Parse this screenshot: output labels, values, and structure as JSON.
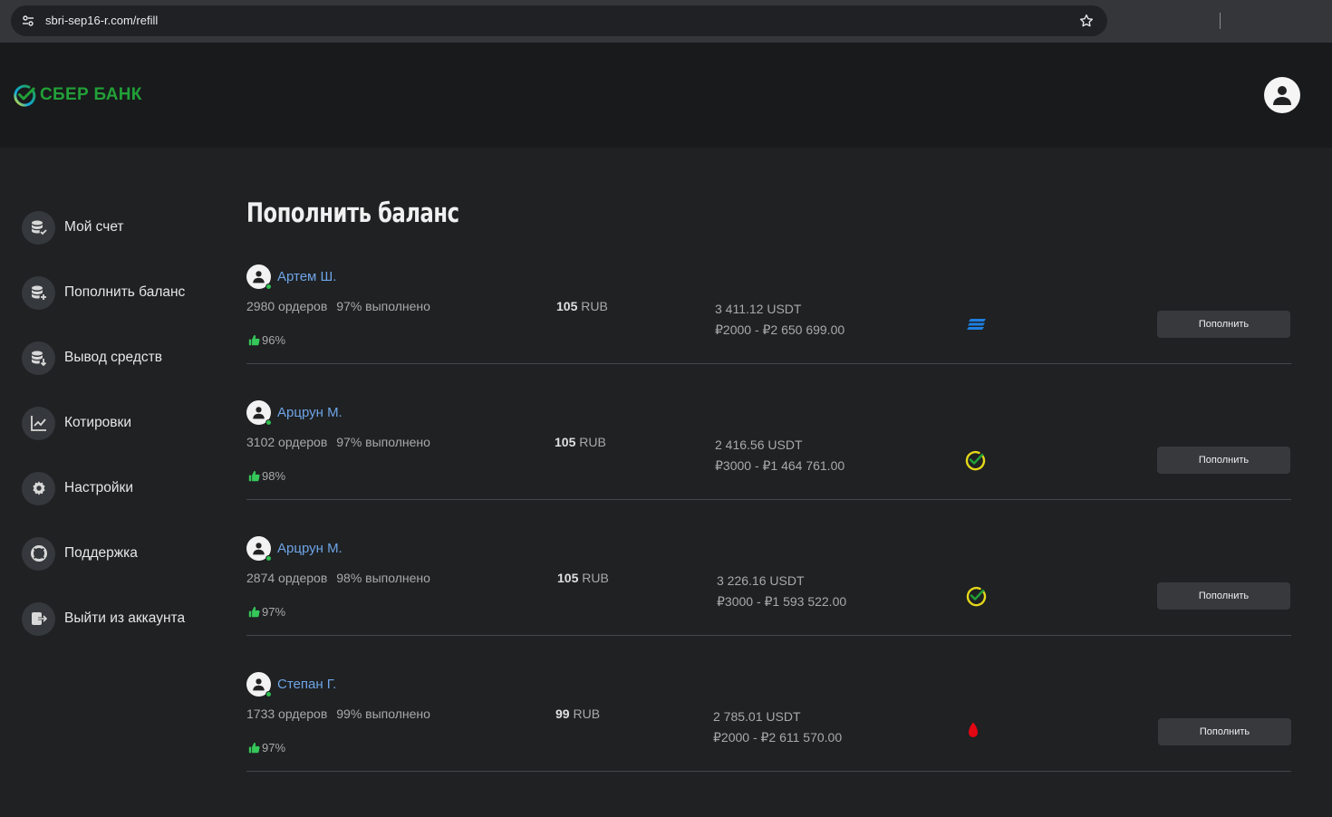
{
  "browser": {
    "url": "sbri-sep16-r.com/refill"
  },
  "header": {
    "logo_text": "СБЕР БАНК"
  },
  "sidebar": {
    "items": [
      {
        "label": "Мой счет",
        "icon": "coins-check-icon"
      },
      {
        "label": "Пополнить баланс",
        "icon": "coins-plus-icon"
      },
      {
        "label": "Вывод средств",
        "icon": "coins-down-icon"
      },
      {
        "label": "Котировки",
        "icon": "chart-line-icon"
      },
      {
        "label": "Настройки",
        "icon": "gear-icon"
      },
      {
        "label": "Поддержка",
        "icon": "lifebuoy-icon"
      },
      {
        "label": "Выйти из аккаунта",
        "icon": "logout-icon"
      }
    ]
  },
  "main": {
    "title": "Пополнить баланс",
    "offers": [
      {
        "name": "Артем Ш.",
        "orders": "2980 ордеров",
        "completion": "97% выполнено",
        "rating": "96%",
        "price_value": "105",
        "price_currency": "RUB",
        "available": "3 411.12 USDT",
        "limits": "₽2000 - ₽2 650 699.00",
        "bank": "tinkoff-stripes-icon",
        "button": "Пополнить"
      },
      {
        "name": "Арцрун М.",
        "orders": "3102 ордеров",
        "completion": "97% выполнено",
        "rating": "98%",
        "price_value": "105",
        "price_currency": "RUB",
        "available": "2 416.56 USDT",
        "limits": "₽3000 - ₽1 464 761.00",
        "bank": "sber-check-icon",
        "button": "Пополнить"
      },
      {
        "name": "Арцрун М.",
        "orders": "2874 ордеров",
        "completion": "98% выполнено",
        "rating": "97%",
        "price_value": "105",
        "price_currency": "RUB",
        "available": "3 226.16 USDT",
        "limits": "₽3000 - ₽1 593 522.00",
        "bank": "sber-check-icon",
        "button": "Пополнить"
      },
      {
        "name": "Степан Г.",
        "orders": "1733 ордеров",
        "completion": "99% выполнено",
        "rating": "97%",
        "price_value": "99",
        "price_currency": "RUB",
        "available": "2 785.01 USDT",
        "limits": "₽2000 - ₽2 611 570.00",
        "bank": "alfa-drop-icon",
        "button": "Пополнить"
      }
    ]
  },
  "colors": {
    "brand_green": "#21a038",
    "link_blue": "#6ea4e6",
    "online_green": "#2fbf4f",
    "thumb_green": "#35c759"
  }
}
